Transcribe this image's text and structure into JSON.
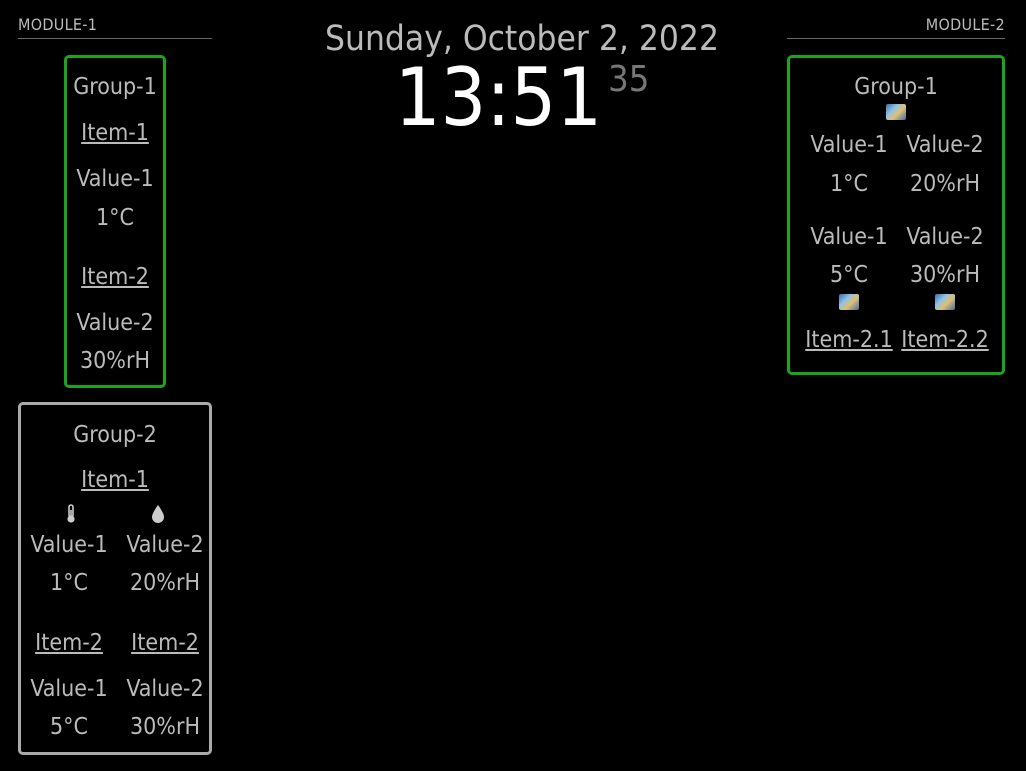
{
  "module1": {
    "header": "MODULE-1",
    "group1": {
      "title": "Group-1",
      "item1": {
        "name": "Item-1",
        "label": "Value-1",
        "value": "1°C"
      },
      "item2": {
        "name": "Item-2",
        "label": "Value-2",
        "value": "30%rH"
      }
    },
    "group2": {
      "title": "Group-2",
      "item1": {
        "name": "Item-1",
        "icon1": "thermometer-icon",
        "icon2": "droplet-icon",
        "label1": "Value-1",
        "label2": "Value-2",
        "value1": "1°C",
        "value2": "20%rH"
      },
      "item2a": {
        "name": "Item-2",
        "label": "Value-1",
        "value": "5°C"
      },
      "item2b": {
        "name": "Item-2",
        "label": "Value-2",
        "value": "30%rH"
      }
    }
  },
  "clock": {
    "date": "Sunday, October 2, 2022",
    "time": "13:51",
    "seconds": "35"
  },
  "module2": {
    "header": "MODULE-2",
    "group1": {
      "title": "Group-1",
      "row1": {
        "label1": "Value-1",
        "label2": "Value-2",
        "value1": "1°C",
        "value2": "20%rH"
      },
      "row2": {
        "label1": "Value-1",
        "label2": "Value-2",
        "value1": "5°C",
        "value2": "30%rH"
      },
      "item21": "Item-2.1",
      "item22": "Item-2.2"
    }
  },
  "colors": {
    "green_border": "#1aa51a",
    "gray_border": "#aaaaaa",
    "background": "#000000"
  }
}
